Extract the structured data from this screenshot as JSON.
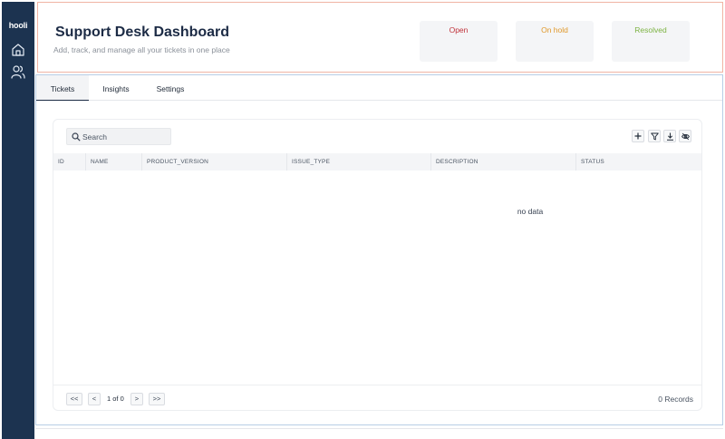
{
  "sidebar": {
    "logo": "hooli",
    "items": [
      {
        "icon": "home-icon"
      },
      {
        "icon": "users-icon"
      }
    ]
  },
  "header": {
    "title": "Support Desk Dashboard",
    "subtitle": "Add, track, and manage all your tickets in one place",
    "stats": [
      {
        "label": "Open",
        "color": "#c0323a"
      },
      {
        "label": "On hold",
        "color": "#e0982a"
      },
      {
        "label": "Resolved",
        "color": "#7cb342"
      }
    ]
  },
  "tabs": [
    {
      "label": "Tickets",
      "active": true
    },
    {
      "label": "Insights",
      "active": false
    },
    {
      "label": "Settings",
      "active": false
    }
  ],
  "table": {
    "search_placeholder": "Search",
    "toolbar": [
      "plus-icon",
      "filter-icon",
      "download-icon",
      "eye-off-icon"
    ],
    "columns": [
      "ID",
      "NAME",
      "PRODUCT_VERSION",
      "ISSUE_TYPE",
      "DESCRIPTION",
      "STATUS"
    ],
    "rows": [],
    "empty_text": "no data"
  },
  "pagination": {
    "first": "<<",
    "prev": "<",
    "info": "1 of 0",
    "next": ">",
    "last": ">>",
    "records": "0 Records"
  },
  "colors": {
    "sidebar": "#1c3350",
    "title": "#1c2b45"
  }
}
